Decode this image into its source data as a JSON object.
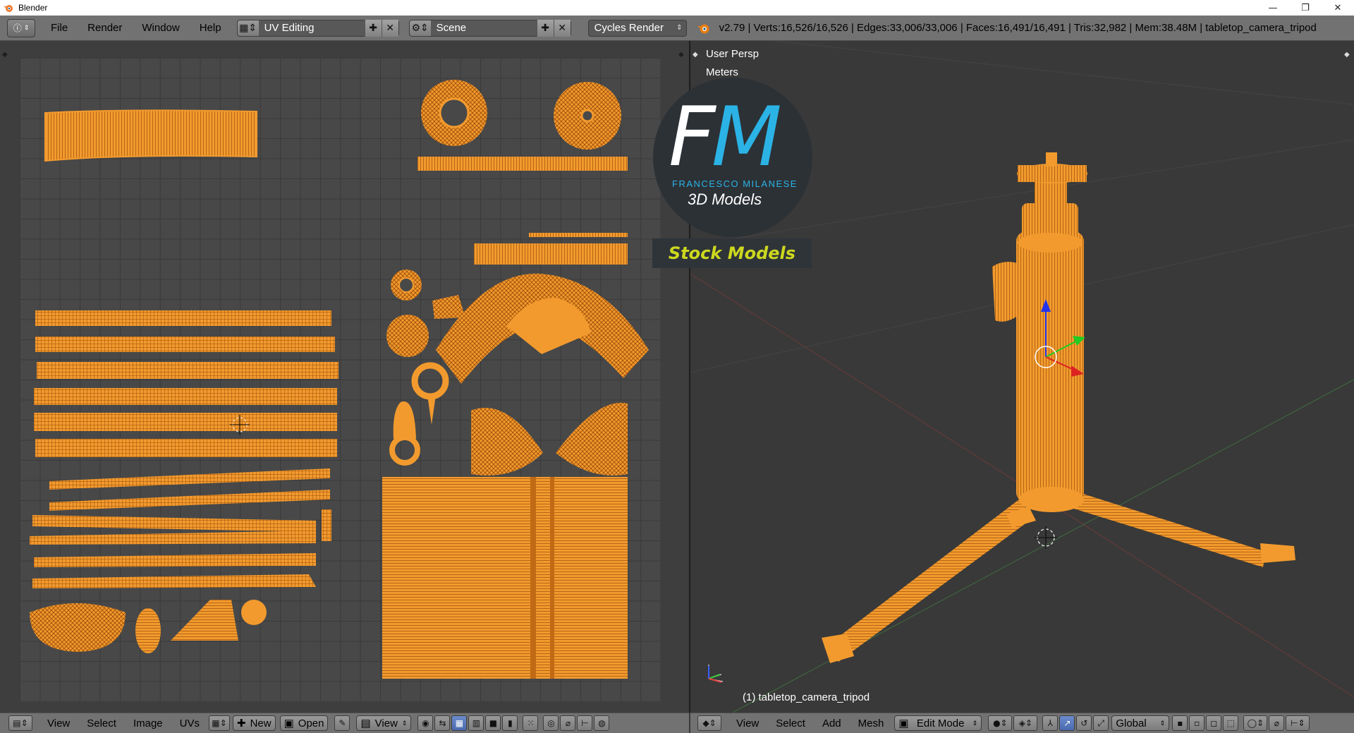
{
  "window": {
    "title": "Blender",
    "minimize": "—",
    "maximize": "❐",
    "close": "✕"
  },
  "info_header": {
    "editor_icon": "info-icon",
    "menus": [
      "File",
      "Render",
      "Window",
      "Help"
    ],
    "screen_layout": "UV Editing",
    "scene": "Scene",
    "render_engine": "Cycles Render",
    "stats": "v2.79 | Verts:16,526/16,526 | Edges:33,006/33,006 | Faces:16,491/16,491 | Tris:32,982 | Mem:38.48M | tabletop_camera_tripod"
  },
  "viewport": {
    "view_name": "User Persp",
    "units": "Meters",
    "object_label": "(1) tabletop_camera_tripod"
  },
  "watermark": {
    "logo_f": "F",
    "logo_m": "M",
    "brand": "FRANCESCO MILANESE",
    "tagline": "3D Models",
    "stock": "Stock Models"
  },
  "uv_footer": {
    "menus": [
      "View",
      "Select",
      "Image",
      "UVs"
    ],
    "new_label": "New",
    "open_label": "Open",
    "view_label": "View"
  },
  "view3d_footer": {
    "menus": [
      "View",
      "Select",
      "Add",
      "Mesh"
    ],
    "mode": "Edit Mode",
    "orientation": "Global"
  },
  "colors": {
    "mesh": "#f29a2e",
    "mesh_dark": "#b5600f",
    "accent_blue": "#2bb3e6",
    "stock_yellow": "#cdd81e"
  }
}
